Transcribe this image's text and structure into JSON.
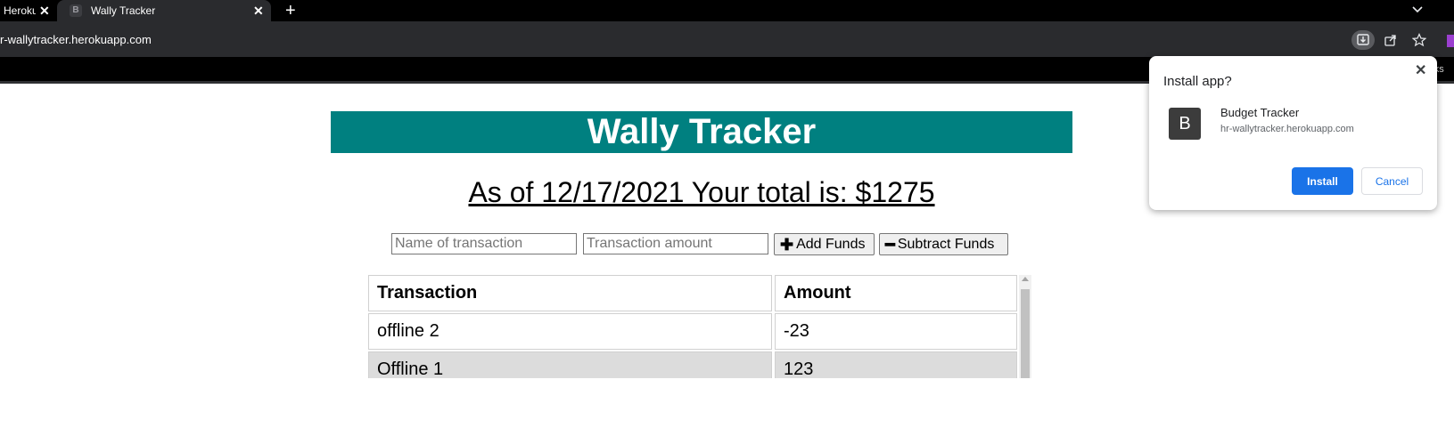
{
  "browser": {
    "tabs": [
      {
        "title": "Heroku",
        "close": "✕"
      },
      {
        "title": "Wally Tracker",
        "favicon": "B",
        "close": "✕"
      }
    ],
    "new_tab": "+",
    "url": "r-wallytracker.herokuapp.com",
    "bookmarks_text": "arks"
  },
  "page": {
    "banner_title": "Wally Tracker",
    "total_text": "As of 12/17/2021 Your total is: $1275",
    "form": {
      "name_placeholder": "Name of transaction",
      "amount_placeholder": "Transaction amount",
      "add_label": "Add Funds",
      "add_glyph": "✚",
      "subtract_label": "Subtract Funds",
      "subtract_glyph": "━"
    },
    "table": {
      "headers": [
        "Transaction",
        "Amount"
      ],
      "rows": [
        [
          "offline 2",
          "-23"
        ],
        [
          "Offline 1",
          "123"
        ]
      ]
    }
  },
  "install_popup": {
    "title": "Install app?",
    "close": "✕",
    "app_icon_letter": "B",
    "app_name": "Budget Tracker",
    "app_url": "hr-wallytracker.herokuapp.com",
    "install_label": "Install",
    "cancel_label": "Cancel"
  },
  "colors": {
    "banner": "#008080",
    "install_button": "#1a73e8",
    "row_highlight": "#dcdcdc"
  }
}
